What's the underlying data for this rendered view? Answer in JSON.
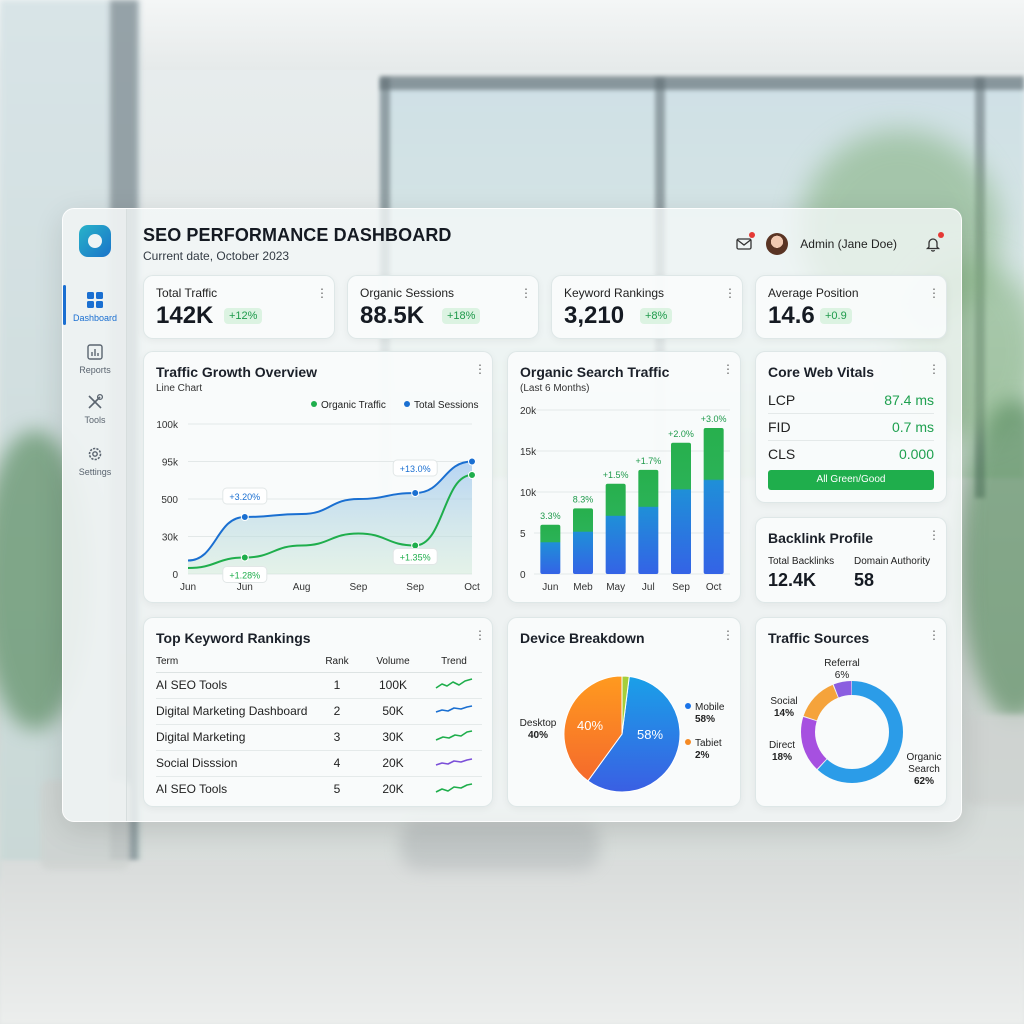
{
  "app": {
    "title": "SEO PERFORMANCE DASHBOARD",
    "subtitle": "Current date, October 2023",
    "user": "Admin (Jane Doe)",
    "accent": "#1a6fd1",
    "positive": "#1e9a4b"
  },
  "sidebar": {
    "items": [
      {
        "label": "Dashboard",
        "icon": "grid-icon",
        "active": true
      },
      {
        "label": "Reports",
        "icon": "report-icon",
        "active": false
      },
      {
        "label": "Tools",
        "icon": "tools-icon",
        "active": false
      },
      {
        "label": "Settings",
        "icon": "gear-icon",
        "active": false
      }
    ]
  },
  "kpis": [
    {
      "label": "Total Traffic",
      "value": "142K",
      "delta": "+12%"
    },
    {
      "label": "Organic Sessions",
      "value": "88.5K",
      "delta": "+18%"
    },
    {
      "label": "Keyword Rankings",
      "value": "3,210",
      "delta": "+8%"
    },
    {
      "label": "Average Position",
      "value": "14.6",
      "delta": "+0.9"
    }
  ],
  "traffic_growth": {
    "title": "Traffic Growth Overview",
    "subtitle": "Line Chart",
    "legend": [
      "Organic Traffic",
      "Total Sessions"
    ],
    "y_ticks": [
      "100k",
      "95k",
      "500",
      "30k",
      "0"
    ],
    "x_ticks": [
      "Jun",
      "Jun",
      "Aug",
      "Sep",
      "Sep",
      "Oct"
    ],
    "annotations": [
      "+3.20%",
      "+13.0%",
      "+1.28%",
      "+1.35%"
    ],
    "colors": {
      "organic": "#1fae4c",
      "sessions": "#1a6fd1"
    }
  },
  "organic_search": {
    "title": "Organic Search Traffic",
    "subtitle": "(Last 6 Months)",
    "y_ticks": [
      "20k",
      "15k",
      "10k",
      "5",
      "0"
    ],
    "categories": [
      "Jun",
      "Meb",
      "May",
      "Jul",
      "Sep",
      "Oct"
    ],
    "labels": [
      "3.3%",
      "8.3%",
      "+1.5%",
      "+1.7%",
      "+2.0%",
      "+3.0%"
    ]
  },
  "core_web_vitals": {
    "title": "Core Web Vitals",
    "rows": [
      {
        "metric": "LCP",
        "value": "87.4 ms"
      },
      {
        "metric": "FID",
        "value": "0.7 ms"
      },
      {
        "metric": "CLS",
        "value": "0.000"
      }
    ],
    "status": "All Green/Good"
  },
  "backlinks": {
    "title": "Backlink Profile",
    "total_label": "Total Backlinks",
    "total_value": "12.4K",
    "da_label": "Domain Authority",
    "da_value": "58"
  },
  "keywords": {
    "title": "Top Keyword Rankings",
    "headers": [
      "Term",
      "Rank",
      "Volume",
      "Trend"
    ],
    "rows": [
      {
        "term": "AI SEO Tools",
        "rank": "1",
        "volume": "100K",
        "trend_color": "#1fae4c"
      },
      {
        "term": "Digital Marketing Dashboard",
        "rank": "2",
        "volume": "50K",
        "trend_color": "#1a6fd1"
      },
      {
        "term": "Digital Marketing",
        "rank": "3",
        "volume": "30K",
        "trend_color": "#1fae4c"
      },
      {
        "term": "Social Disssion",
        "rank": "4",
        "volume": "20K",
        "trend_color": "#7b4fd8"
      },
      {
        "term": "AI SEO Tools",
        "rank": "5",
        "volume": "20K",
        "trend_color": "#1fae4c"
      }
    ]
  },
  "device": {
    "title": "Device Breakdown",
    "desktop_label": "Desktop",
    "desktop_pct": "40%",
    "mobile_label": "Mobile",
    "mobile_pct": "58%",
    "tablet_label": "Tabiet",
    "tablet_pct": "2%"
  },
  "sources": {
    "title": "Traffic Sources",
    "items": [
      {
        "name": "Referral",
        "pct": "6%"
      },
      {
        "name": "Social",
        "pct": "14%"
      },
      {
        "name": "Direct",
        "pct": "18%"
      },
      {
        "name": "Organic",
        "name2": "Search",
        "pct": "62%"
      }
    ]
  },
  "chart_data": [
    {
      "type": "line",
      "title": "Traffic Growth Overview",
      "x": [
        "Jun",
        "Jun",
        "Aug",
        "Sep",
        "Sep",
        "Oct"
      ],
      "series": [
        {
          "name": "Organic Traffic",
          "values": [
            4,
            11,
            19,
            27,
            19,
            66
          ]
        },
        {
          "name": "Total Sessions",
          "values": [
            9,
            38,
            40,
            50,
            54,
            75
          ]
        }
      ]
    },
    {
      "type": "bar",
      "title": "Organic Search Traffic",
      "categories": [
        "Jun",
        "Meb",
        "May",
        "Jul",
        "Sep",
        "Oct"
      ],
      "values": [
        6000,
        8000,
        11000,
        12700,
        16000,
        17800
      ]
    },
    {
      "type": "pie",
      "title": "Device Breakdown",
      "categories": [
        "Mobile",
        "Desktop",
        "Tabiet"
      ],
      "values": [
        58,
        40,
        2
      ]
    },
    {
      "type": "pie",
      "title": "Traffic Sources",
      "categories": [
        "Organic Search",
        "Direct",
        "Social",
        "Referral"
      ],
      "values": [
        62,
        18,
        14,
        6
      ]
    }
  ]
}
